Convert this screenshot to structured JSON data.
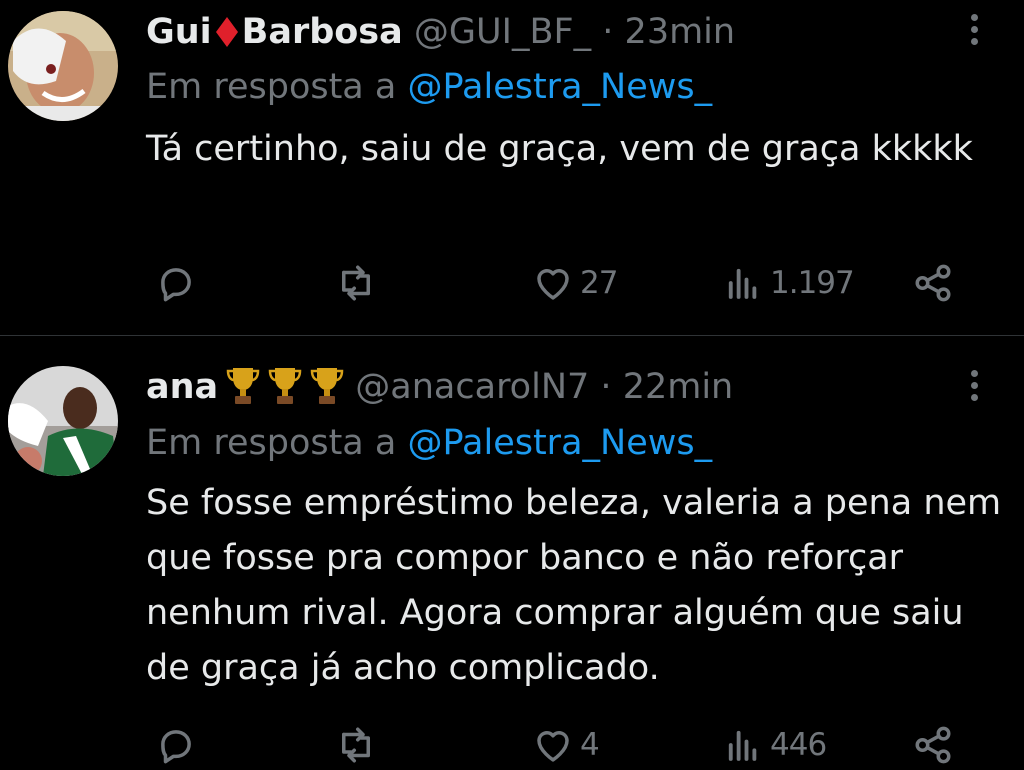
{
  "tweets": [
    {
      "name_first": "Gui",
      "name_last": "Barbosa",
      "handle": "@GUI_BF_",
      "separator": "·",
      "time": "23min",
      "reply_prefix": "Em resposta a",
      "reply_to": "@Palestra_News_",
      "text": "Tá certinho, saiu de graça, vem de graça kkkkk",
      "likes": "27",
      "views": "1.197",
      "name_emoji": "diamond-icon",
      "accent": "#e0202b"
    },
    {
      "name": "ana",
      "handle": "@anacarolN7",
      "separator": "·",
      "time": "22min",
      "reply_prefix": "Em resposta a",
      "reply_to": "@Palestra_News_",
      "text": "Se fosse empréstimo beleza, valeria a pena nem que fosse pra compor banco e não reforçar nenhum rival. Agora comprar alguém que saiu de graça já acho complicado.",
      "likes": "4",
      "views": "446",
      "name_emoji": "trophy-icon",
      "accent": "#d8a21a"
    }
  ],
  "colors": {
    "background": "#000000",
    "text": "#e7e9ea",
    "muted": "#71767b",
    "link": "#1d9bf0",
    "divider": "#2f3336"
  }
}
